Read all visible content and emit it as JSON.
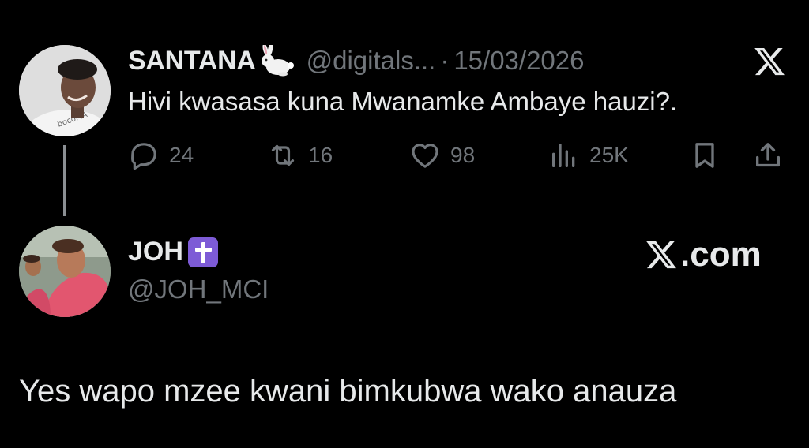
{
  "tweet": {
    "display_name": "SANTANA",
    "name_emoji": "rabbit",
    "handle": "@digitals...",
    "separator": "·",
    "date": "15/03/2026",
    "text": "Hivi kwasasa kuna Mwanamke Ambaye hauzi?.",
    "avatar_label": "profile photo",
    "brand_icon": "x-logo-icon",
    "actions": {
      "replies": "24",
      "reposts": "16",
      "likes": "98",
      "views": "25K"
    }
  },
  "reply": {
    "display_name": "JOH",
    "name_emoji": "latin-cross",
    "handle": "@JOH_MCI",
    "brand_label": ".com",
    "text": "Yes wapo mzee kwani bimkubwa wako anauza"
  },
  "colors": {
    "background": "#000000",
    "primary_text": "#e7e9ea",
    "secondary_text": "#71767b",
    "cross_badge": "#7d5bd6"
  }
}
